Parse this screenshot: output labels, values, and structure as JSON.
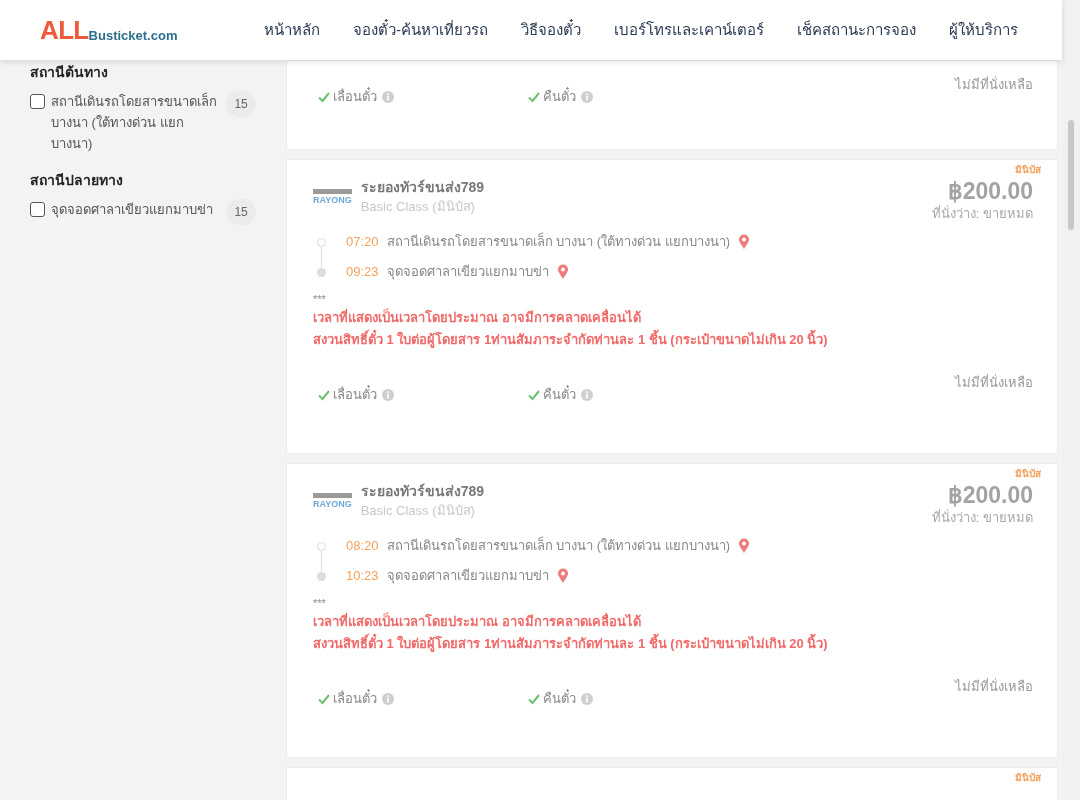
{
  "header": {
    "logo": {
      "brand": "ALL",
      "domain": "Busticket.com"
    },
    "nav": [
      {
        "label": "หน้าหลัก"
      },
      {
        "label": "จองตั๋ว-ค้นหาเที่ยวรถ"
      },
      {
        "label": "วิธีจองตั๋ว"
      },
      {
        "label": "เบอร์โทรและเคาน์เตอร์"
      },
      {
        "label": "เช็คสถานะการจอง"
      },
      {
        "label": "ผู้ให้บริการ"
      }
    ]
  },
  "sidebar": {
    "sections": [
      {
        "title": "สถานีต้นทาง",
        "options": [
          {
            "label": "สถานีเดินรถโดยสารขนาดเล็ก บางนา (ใต้ทางด่วน แยกบางนา)",
            "count": "15",
            "checked": false
          }
        ]
      },
      {
        "title": "สถานีปลายทาง",
        "options": [
          {
            "label": "จุดจอดศาลาเขียวแยกมาบข่า",
            "count": "15",
            "checked": false
          }
        ]
      }
    ]
  },
  "trips": [
    {
      "kind": "partial",
      "features": [
        {
          "label": "เลื่อนตั๋ว",
          "available": true
        },
        {
          "label": "คืนตั๋ว",
          "available": true
        }
      ],
      "status": "ไม่มีที่นั่งเหลือ"
    },
    {
      "kind": "full",
      "tag": "มินิบัส",
      "operator_logo": "RAYONG",
      "operator": "ระยองทัวร์ขนส่ง789",
      "bus_class": "Basic Class (มินิบัส)",
      "price": "฿200.00",
      "seats": "ที่นั่งว่าง: ขายหมด",
      "stops": [
        {
          "time": "07:20",
          "place": "สถานีเดินรถโดยสารขนาดเล็ก บางนา (ใต้ทางด่วน แยกบางนา)"
        },
        {
          "time": "09:23",
          "place": "จุดจอดศาลาเขียวแยกมาบข่า"
        }
      ],
      "note_mark": "***",
      "notes": [
        "เวลาที่แสดงเป็นเวลาโดยประมาณ อาจมีการคลาดเคลื่อนได้",
        "สงวนสิทธิ์ตั๋ว 1 ใบต่อผู้โดยสาร 1ท่านสัมภาระจำกัดท่านละ 1 ชิ้น (กระเป๋าขนาดไม่เกิน 20 นิ้ว)"
      ],
      "features": [
        {
          "label": "เลื่อนตั๋ว",
          "available": true
        },
        {
          "label": "คืนตั๋ว",
          "available": true
        }
      ],
      "status": "ไม่มีที่นั่งเหลือ"
    },
    {
      "kind": "full",
      "tag": "มินิบัส",
      "operator_logo": "RAYONG",
      "operator": "ระยองทัวร์ขนส่ง789",
      "bus_class": "Basic Class (มินิบัส)",
      "price": "฿200.00",
      "seats": "ที่นั่งว่าง: ขายหมด",
      "stops": [
        {
          "time": "08:20",
          "place": "สถานีเดินรถโดยสารขนาดเล็ก บางนา (ใต้ทางด่วน แยกบางนา)"
        },
        {
          "time": "10:23",
          "place": "จุดจอดศาลาเขียวแยกมาบข่า"
        }
      ],
      "note_mark": "***",
      "notes": [
        "เวลาที่แสดงเป็นเวลาโดยประมาณ อาจมีการคลาดเคลื่อนได้",
        "สงวนสิทธิ์ตั๋ว 1 ใบต่อผู้โดยสาร 1ท่านสัมภาระจำกัดท่านละ 1 ชิ้น (กระเป๋าขนาดไม่เกิน 20 นิ้ว)"
      ],
      "features": [
        {
          "label": "เลื่อนตั๋ว",
          "available": true
        },
        {
          "label": "คืนตั๋ว",
          "available": true
        }
      ],
      "status": "ไม่มีที่นั่งเหลือ"
    },
    {
      "kind": "cut",
      "tag": "มินิบัส"
    }
  ]
}
